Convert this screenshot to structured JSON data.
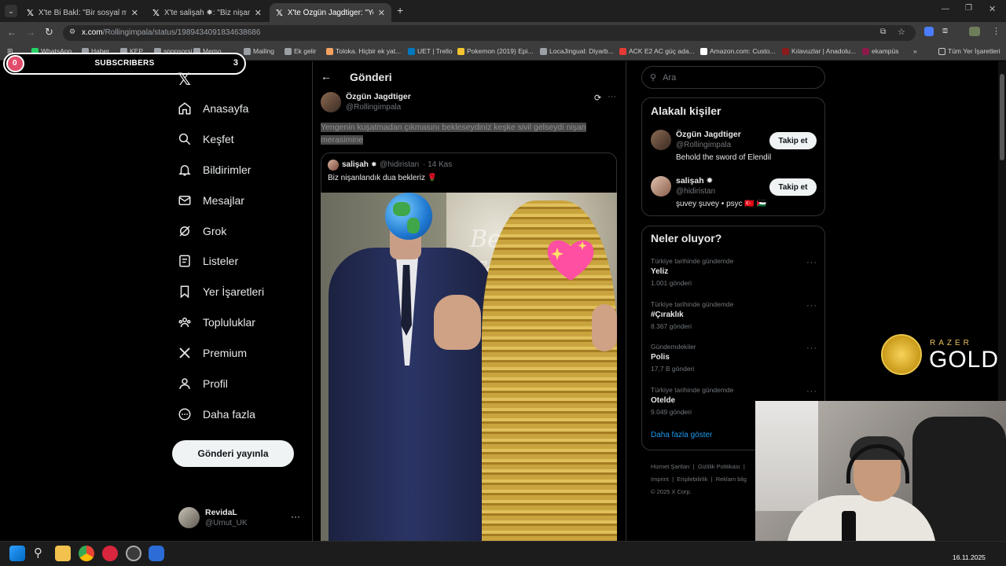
{
  "tabs": [
    {
      "title": "X'te Bi Bakl: \"Bir sosyal medya"
    },
    {
      "title": "X'te salişah ✸: \"Biz nişanlandık"
    },
    {
      "title": "X'te Özgün Jagdtiger: \"Yengenin"
    }
  ],
  "new_tab_label": "+",
  "address": {
    "host": "x.com",
    "path": "/Rollingimpala/status/1989434091834638686"
  },
  "bookmarks": [
    {
      "label": "WhatsApp",
      "color": "#25d366"
    },
    {
      "label": "Haber",
      "color": "#9aa0a6"
    },
    {
      "label": "KEP",
      "color": "#9aa0a6"
    },
    {
      "label": "sponsorsi",
      "color": "#9aa0a6"
    },
    {
      "label": "Memo",
      "color": "#9aa0a6"
    },
    {
      "label": "Mailing",
      "color": "#9aa0a6"
    },
    {
      "label": "Ek gelir",
      "color": "#9aa0a6"
    },
    {
      "label": "Toloka. Hiçbir ek yat...",
      "color": "#f4a261"
    },
    {
      "label": "UET | Trello",
      "color": "#0079bf"
    },
    {
      "label": "Pokemon (2019) Epi...",
      "color": "#f4c430"
    },
    {
      "label": "LocaJingual: Diyarb...",
      "color": "#9aa0a6"
    },
    {
      "label": "ACK E2 AC güç ada...",
      "color": "#e53935"
    },
    {
      "label": "Amazon.com: Custo...",
      "color": "#ffffff"
    },
    {
      "label": "Kılavuzlar | Anadolu...",
      "color": "#8b1a1a"
    },
    {
      "label": "ekampüs",
      "color": "#8b1a4a"
    }
  ],
  "bookmarks_more": "»",
  "bookmarks_all": "Tüm Yer İşaretleri",
  "overlay": {
    "label": "SUBSCRIBERS",
    "count": "3",
    "left_count": "0"
  },
  "nav": [
    {
      "label": "Anasayfa",
      "icon": "home-icon"
    },
    {
      "label": "Keşfet",
      "icon": "search-icon"
    },
    {
      "label": "Bildirimler",
      "icon": "bell-icon"
    },
    {
      "label": "Mesajlar",
      "icon": "mail-icon"
    },
    {
      "label": "Grok",
      "icon": "grok-icon"
    },
    {
      "label": "Listeler",
      "icon": "list-icon"
    },
    {
      "label": "Yer İşaretleri",
      "icon": "bookmark-icon"
    },
    {
      "label": "Topluluklar",
      "icon": "community-icon"
    },
    {
      "label": "Premium",
      "icon": "x-logo-icon"
    },
    {
      "label": "Profil",
      "icon": "person-icon"
    },
    {
      "label": "Daha fazla",
      "icon": "more-circle-icon"
    }
  ],
  "post_button": "Gönderi yayınla",
  "account": {
    "name": "RevidaL",
    "handle": "@Umut_UK",
    "menu": "···"
  },
  "post": {
    "header": "Gönderi",
    "author_name": "Özgün Jagdtiger",
    "author_handle": "@Rollingimpala",
    "menu": "···",
    "text": "Yengenin kuşatmadan çıkmasını bekleseydiniz keşke sivil gelseydi nişan merasimine"
  },
  "quote": {
    "author_name": "salişah",
    "author_handle": "@hidiristan",
    "date": "· 14 Kas",
    "text": "Biz nişanlandık dua bekleriz 🌹",
    "photo_sign": "Be Togethe"
  },
  "search": {
    "placeholder": "Ara"
  },
  "related": {
    "title": "Alakalı kişiler",
    "people": [
      {
        "name": "Özgün Jagdtiger",
        "handle": "@Rollingimpala",
        "bio": "Behold the sword of Elendil",
        "button": "Takip et"
      },
      {
        "name": "salişah ✸",
        "handle": "@hidiristan",
        "bio": "şuvey şuvey • psyc 🇹🇷 🇵🇸",
        "button": "Takip et"
      }
    ]
  },
  "trends": {
    "title": "Neler oluyor?",
    "items": [
      {
        "context": "Türkiye tarihinde gündemde",
        "name": "Yeliz",
        "count": "1.001 gönderi"
      },
      {
        "context": "Türkiye tarihinde gündemde",
        "name": "#Çıraklık",
        "count": "8.367 gönderi"
      },
      {
        "context": "Gündemdekiler",
        "name": "Polis",
        "count": "17,7 B gönderi"
      },
      {
        "context": "Türkiye tarihinde gündemde",
        "name": "Otelde",
        "count": "9.049 gönderi"
      }
    ],
    "more": "Daha fazla göster"
  },
  "footer": {
    "line1": [
      "Hizmet Şartları",
      "Gizlilik Politikası"
    ],
    "line2": [
      "Imprint",
      "Erişilebilirlik",
      "Reklam bilg"
    ],
    "copyright": "© 2025 X Corp."
  },
  "razer": {
    "brand": "RAZER",
    "gold": "GOLD"
  },
  "taskbar": {
    "date": "16.11.2025"
  }
}
